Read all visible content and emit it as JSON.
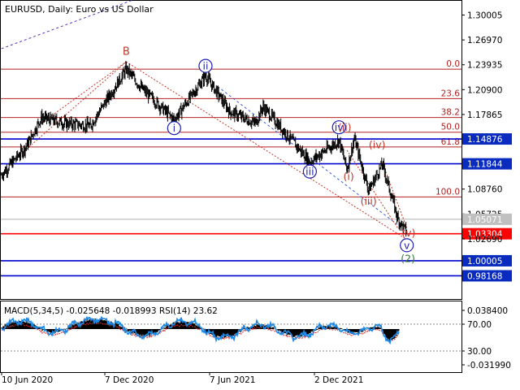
{
  "header": {
    "symbol": "EURUSD",
    "timeframe": "Daily",
    "description": "Euro vs US Dollar"
  },
  "colors": {
    "candles": "#000000",
    "fib_lines": "#b22222",
    "support_blue": "#0000cd",
    "resistance_red": "#ff0000",
    "blue_wave": "#1f1fb4",
    "red_wave": "#c0392b",
    "green_wave": "#2e7d32",
    "macd_hist": "#000000",
    "macd_signal": "#d32f2f",
    "rsi": "#1e88e5",
    "axis_badge_blue": "#0a2bbf",
    "axis_badge_red": "#ff0000",
    "axis_badge_gray": "#c0c0c0"
  },
  "chart_data": [
    {
      "type": "candlestick",
      "title": "EURUSD, Daily:  Euro vs US Dollar",
      "ylim": [
        0.97,
        1.31
      ],
      "price_ticks": [
        "1.30005",
        "1.26970",
        "1.23935",
        "1.20900",
        "1.17865",
        "1.14876",
        "1.11844",
        "1.08760",
        "1.05725",
        "1.05071",
        "1.03304",
        "1.02690",
        "1.00005",
        "0.98168"
      ],
      "x_labels": [
        "10 Jun 2020",
        "7 Dec 2020",
        "7 Jun 2021",
        "2 Dec 2021"
      ],
      "close_path": [
        {
          "date": "2020-06-01",
          "price": 1.105
        },
        {
          "date": "2020-07-15",
          "price": 1.14
        },
        {
          "date": "2020-08-10",
          "price": 1.175
        },
        {
          "date": "2020-09-20",
          "price": 1.168
        },
        {
          "date": "2020-11-04",
          "price": 1.165
        },
        {
          "date": "2021-01-06",
          "price": 1.234
        },
        {
          "date": "2021-02-03",
          "price": 1.21
        },
        {
          "date": "2021-03-31",
          "price": 1.172
        },
        {
          "date": "2021-05-25",
          "price": 1.226
        },
        {
          "date": "2021-07-07",
          "price": 1.182
        },
        {
          "date": "2021-08-20",
          "price": 1.168
        },
        {
          "date": "2021-09-03",
          "price": 1.188
        },
        {
          "date": "2021-11-24",
          "price": 1.121
        },
        {
          "date": "2022-01-14",
          "price": 1.147
        },
        {
          "date": "2022-01-28",
          "price": 1.112
        },
        {
          "date": "2022-02-10",
          "price": 1.149
        },
        {
          "date": "2022-03-07",
          "price": 1.086
        },
        {
          "date": "2022-03-31",
          "price": 1.118
        },
        {
          "date": "2022-04-28",
          "price": 1.05
        },
        {
          "date": "2022-05-13",
          "price": 1.035
        }
      ],
      "fib_levels": [
        {
          "label": "0.0",
          "price": 1.234
        },
        {
          "label": "23.6",
          "price": 1.198
        },
        {
          "label": "38.2",
          "price": 1.175
        },
        {
          "label": "50.0",
          "price": 1.157
        },
        {
          "label": "61.8",
          "price": 1.139
        },
        {
          "label": "100.0",
          "price": 1.078
        }
      ],
      "horizontal_levels": [
        {
          "price": 1.14876,
          "label": "1.14876",
          "style": "blue"
        },
        {
          "price": 1.11844,
          "label": "1.11844",
          "style": "blue"
        },
        {
          "price": 1.05071,
          "label": "1.05071",
          "style": "gray"
        },
        {
          "price": 1.03304,
          "label": "1.03304",
          "style": "red"
        },
        {
          "price": 1.00005,
          "label": "1.00005",
          "style": "blue"
        },
        {
          "price": 0.98168,
          "label": "0.98168",
          "style": "blue"
        }
      ],
      "wave_labels": [
        {
          "text": "B",
          "date": "2021-01-06",
          "price": 1.256,
          "style": "plain-red"
        },
        {
          "text": "i",
          "date": "2021-03-31",
          "price": 1.162,
          "style": "circle-blue"
        },
        {
          "text": "ii",
          "date": "2021-05-25",
          "price": 1.238,
          "style": "circle-blue"
        },
        {
          "text": "iii",
          "date": "2021-11-24",
          "price": 1.109,
          "style": "circle-blue"
        },
        {
          "text": "iv",
          "date": "2022-01-14",
          "price": 1.163,
          "style": "circle-blue"
        },
        {
          "text": "v",
          "date": "2022-05-13",
          "price": 1.019,
          "style": "circle-blue"
        },
        {
          "text": "(ii)",
          "date": "2022-01-24",
          "price": 1.163,
          "style": "plain-red"
        },
        {
          "text": "(i)",
          "date": "2022-01-31",
          "price": 1.103,
          "style": "plain-red"
        },
        {
          "text": "(iv)",
          "date": "2022-03-22",
          "price": 1.142,
          "style": "plain-red"
        },
        {
          "text": "(iii)",
          "date": "2022-03-07",
          "price": 1.073,
          "style": "plain-red"
        },
        {
          "text": "(v)",
          "date": "2022-05-16",
          "price": 1.034,
          "style": "plain-red"
        },
        {
          "text": "(2)",
          "date": "2022-05-15",
          "price": 1.003,
          "style": "plain-green"
        }
      ]
    },
    {
      "type": "line",
      "title": "MACD(5,34,5) -0.025648 -0.018993 RSI(14) 23.62",
      "indicator": "MACD(5,34,5)",
      "macd": -0.025648,
      "signal": -0.018993,
      "rsi_label": "RSI(14)",
      "rsi": 23.62,
      "y_ticks": [
        "0.038400",
        "70.00",
        "30.00",
        "-0.031990"
      ]
    }
  ]
}
